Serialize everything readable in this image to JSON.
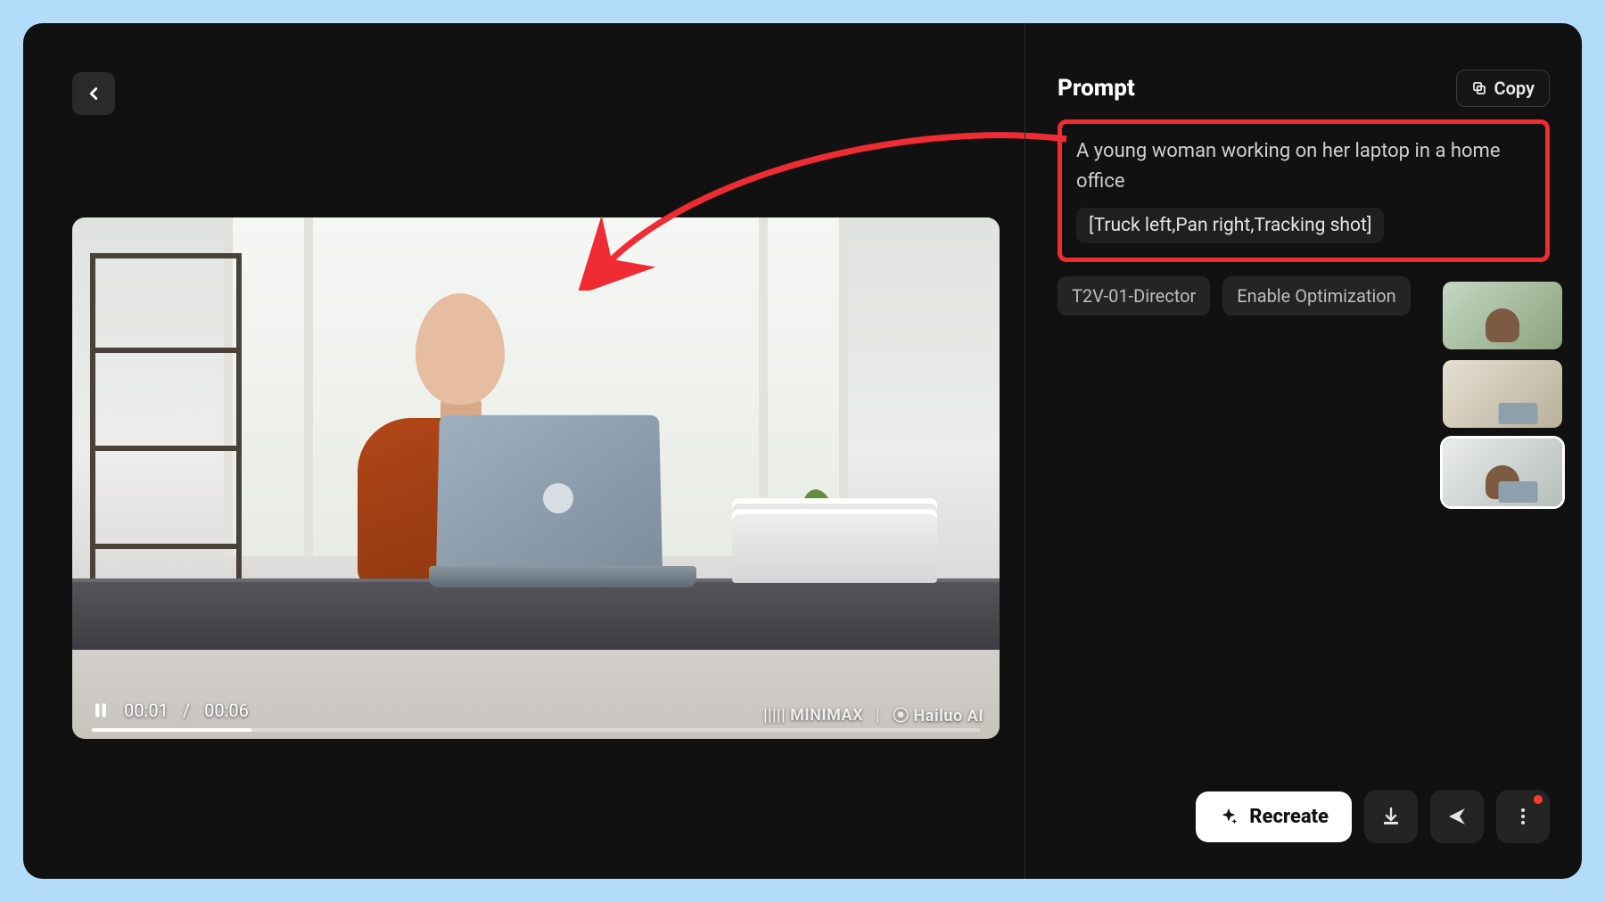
{
  "panel": {
    "title": "Prompt",
    "copy_label": "Copy",
    "prompt_text": "A young woman working on her laptop in a home office",
    "camera_moves": "[Truck left,Pan right,Tracking shot]",
    "tags": [
      "T2V-01-Director",
      "Enable Optimization"
    ]
  },
  "video": {
    "current_time": "00:01",
    "duration": "00:06",
    "separator": "/",
    "watermark_left": "||||| MINIMAX",
    "watermark_right": "⦿ Hailuo AI"
  },
  "buttons": {
    "recreate": "Recreate"
  },
  "thumbnails": [
    {
      "id": "thumb-1",
      "selected": false
    },
    {
      "id": "thumb-2",
      "selected": false
    },
    {
      "id": "thumb-3",
      "selected": true
    }
  ],
  "colors": {
    "highlight": "#ef2b33",
    "page_bg": "#b3dcfa",
    "app_bg": "#111111"
  }
}
